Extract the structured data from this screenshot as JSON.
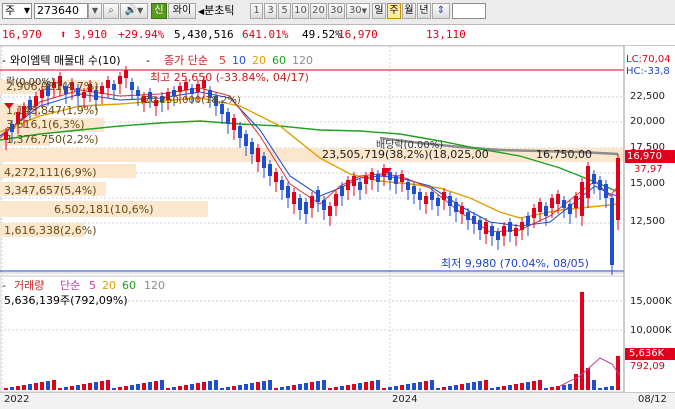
{
  "toolbar": {
    "market": "주",
    "code": "273640",
    "name_tab": "와이",
    "new_badge": "신",
    "chart_type": "분초틱",
    "intervals": [
      "1",
      "3",
      "5",
      "10",
      "20",
      "30"
    ],
    "count": "30",
    "periods": [
      "일",
      "주",
      "월",
      "년"
    ],
    "active_period": "주"
  },
  "quote": {
    "price": "16,970",
    "change": "3,910",
    "change_pct": "+29.94%",
    "volume": "5,430,516",
    "volume_pct": "641.01%",
    "turnover_pct": "49.52%",
    "price2": "16,970",
    "prev": "13,110"
  },
  "legend": {
    "title": "와이엠텍 매물대 수(10)",
    "ma_label": "종가 단순",
    "ma_periods": [
      "5",
      "10",
      "20",
      "60",
      "120"
    ],
    "ma_colors": [
      "#E03030",
      "#2050D0",
      "#E0A000",
      "#20A020",
      "#8C8C8C"
    ]
  },
  "annotations": {
    "high": "최고 25,650 (-33.84%, 04/17)",
    "low": "최저 9,980 (70.04%, 08/05)",
    "dividend": "배당락(0.00%)",
    "rights": "락(0.00%)",
    "lc": "LC:70,04",
    "hc": "HC:-33,8",
    "current_tag": "16,970",
    "ratio_tag": "37,97",
    "midline": "23,505,719(38,2%)(18,025,00",
    "mid2": "16,750,00",
    "ghost": "(20,250,000(18,2%)"
  },
  "volume_profile": [
    {
      "label": "2,906,961(4,7%)"
    },
    {
      "label": "1,143,847(1,9%)"
    },
    {
      "label": "3,616,1(6,3%)"
    },
    {
      "label": "1,376,750(2,2%)"
    },
    {
      "label": "4,272,111(6,9%)"
    },
    {
      "label": "3,347,657(5,4%)"
    },
    {
      "label": "6,502,181(10,6%)"
    },
    {
      "label": "1,616,338(2,6%)"
    }
  ],
  "price_axis": [
    "22,500",
    "20,000",
    "17,500",
    "15,000",
    "12,500"
  ],
  "volume_panel": {
    "title": "거래량",
    "ma_label": "단순",
    "ma_periods": [
      "5",
      "20",
      "60",
      "120"
    ],
    "value": "5,636,139주(792,09%)",
    "axis": [
      "15,000K",
      "10,000K"
    ],
    "tag": "5,636K",
    "tag2": "792,09"
  },
  "date_axis": [
    "2022",
    "2024",
    "08/12"
  ],
  "colors": {
    "up": "#E0001B",
    "down": "#1F4FD0",
    "band": "#FBE7CD"
  }
}
